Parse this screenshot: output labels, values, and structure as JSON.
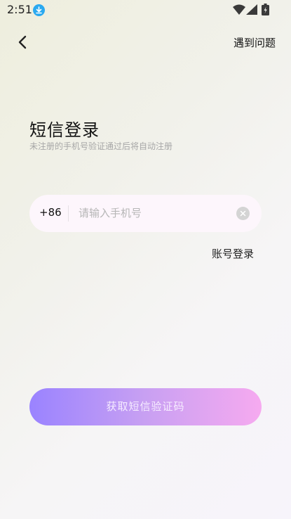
{
  "status_bar": {
    "time": "2:51"
  },
  "header": {
    "help_label": "遇到问题"
  },
  "login": {
    "title": "短信登录",
    "subtitle": "未注册的手机号验证通过后将自动注册",
    "country_code": "+86",
    "phone_placeholder": "请输入手机号",
    "phone_value": "",
    "account_login_label": "账号登录",
    "submit_label": "获取短信验证码"
  },
  "colors": {
    "button_gradient_start": "#9a83ff",
    "button_gradient_end": "#f6aaf0",
    "input_background": "#fdf6fc",
    "download_icon": "#2aa9f0"
  },
  "icons": [
    "download-icon",
    "wifi-icon",
    "signal-icon",
    "battery-icon",
    "back-arrow-icon",
    "clear-icon"
  ]
}
